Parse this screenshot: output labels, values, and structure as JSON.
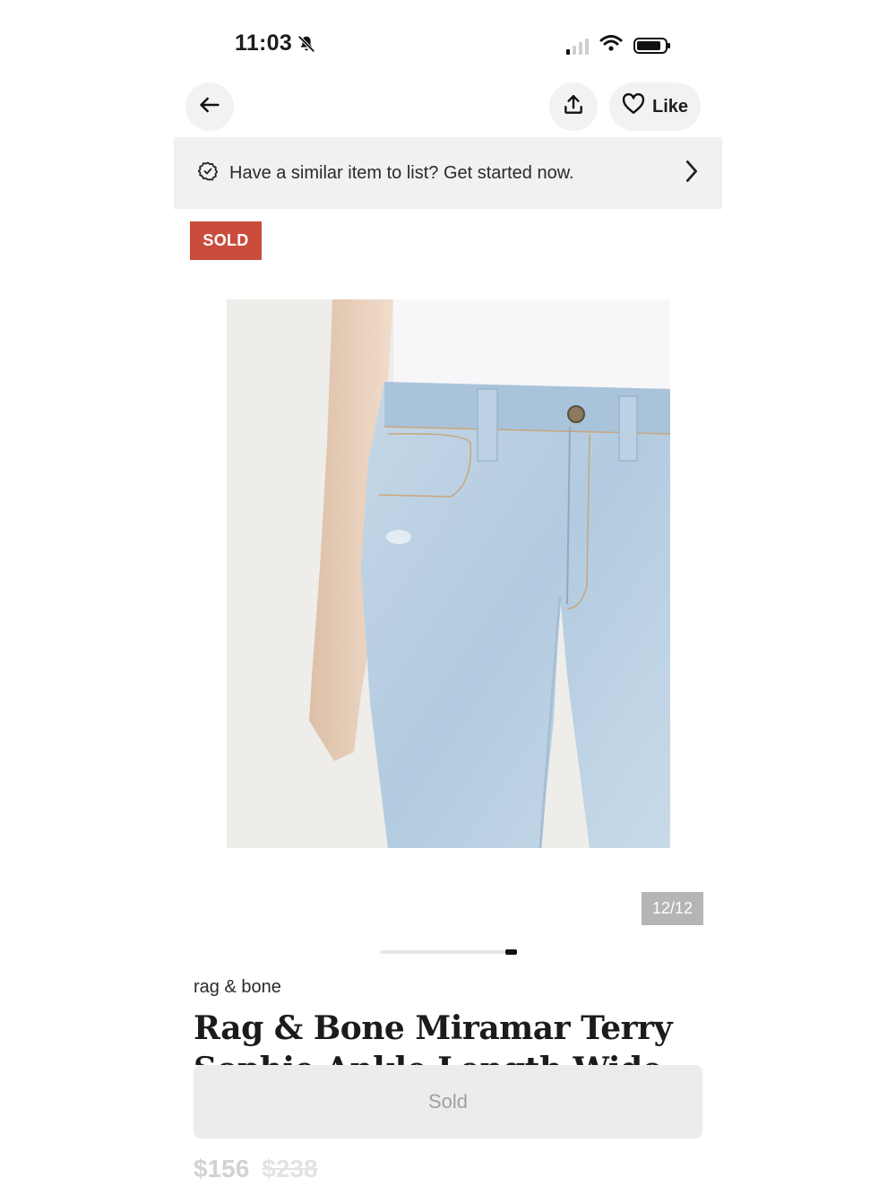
{
  "status_bar": {
    "time": "11:03"
  },
  "header": {
    "like_label": "Like"
  },
  "banner": {
    "text": "Have a similar item to list? Get started now."
  },
  "badge": {
    "label": "SOLD",
    "color": "#c94c3d"
  },
  "gallery": {
    "counter": "12/12",
    "current_page": 12,
    "total_pages": 12
  },
  "product": {
    "brand": "rag & bone",
    "title": "Rag & Bone Miramar Terry Sophie Ankle Length Wide Leg",
    "price": "$156",
    "original_price": "$238"
  },
  "action": {
    "sold_label": "Sold"
  }
}
